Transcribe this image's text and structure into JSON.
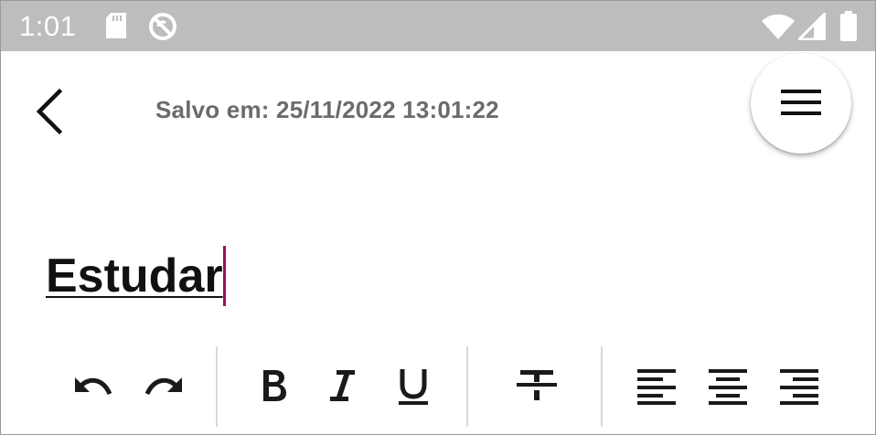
{
  "status_bar": {
    "time": "1:01",
    "icons": [
      "sd-card-icon",
      "sync-off-icon",
      "wifi-icon",
      "signal-icon",
      "battery-icon"
    ]
  },
  "header": {
    "saved_label": "Salvo em: 25/11/2022 13:01:22",
    "back_icon": "back-arrow-icon",
    "menu_icon": "hamburger-menu-icon"
  },
  "note": {
    "title": "Estudar"
  },
  "toolbar": {
    "groups": [
      [
        "undo-icon",
        "redo-icon"
      ],
      [
        "bold-icon",
        "italic-icon",
        "underline-icon"
      ],
      [
        "strikethrough-icon"
      ],
      [
        "align-left-icon",
        "align-center-icon",
        "align-right-icon"
      ]
    ]
  },
  "colors": {
    "status_bar": "#bdbdbd",
    "saved_text": "#6b6b6b",
    "cursor": "#9c1257",
    "icon": "#1a1a1a"
  }
}
